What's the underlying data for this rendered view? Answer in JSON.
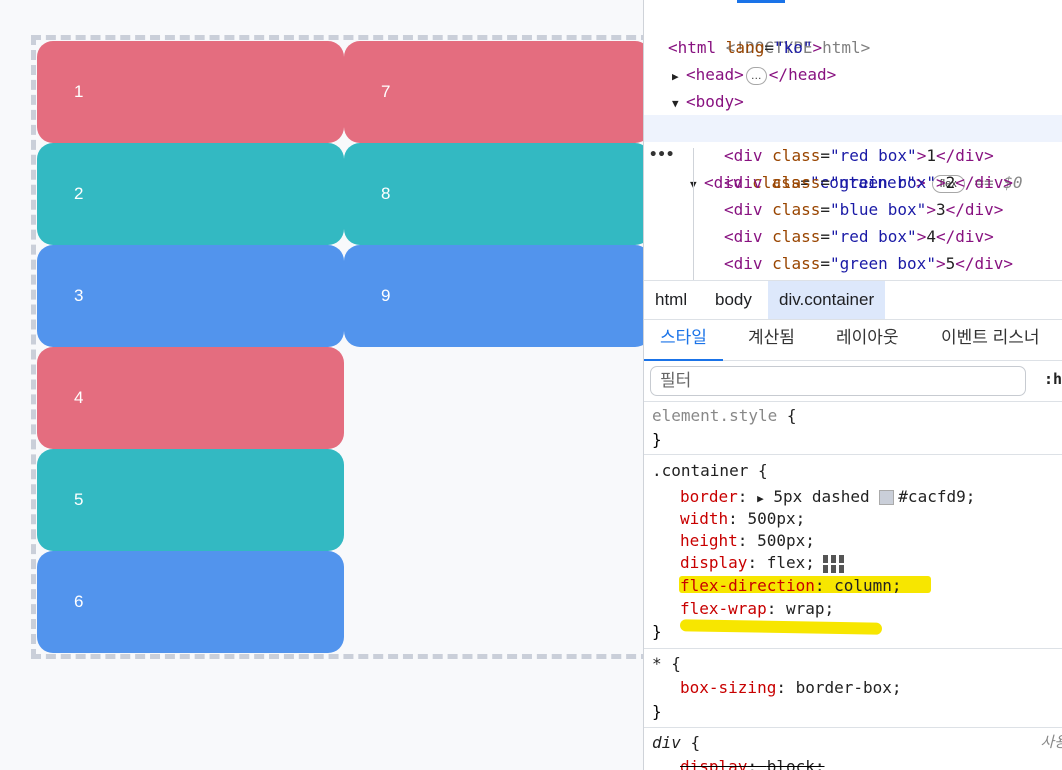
{
  "preview": {
    "boxes": [
      {
        "label": "1",
        "color": "#e46d7f"
      },
      {
        "label": "2",
        "color": "#33b9c2"
      },
      {
        "label": "3",
        "color": "#5294ed"
      },
      {
        "label": "4",
        "color": "#e46d7f"
      },
      {
        "label": "5",
        "color": "#33b9c2"
      },
      {
        "label": "6",
        "color": "#5294ed"
      },
      {
        "label": "7",
        "color": "#e46d7f"
      },
      {
        "label": "8",
        "color": "#33b9c2"
      },
      {
        "label": "9",
        "color": "#5294ed"
      }
    ],
    "border_color": "#cacfd9"
  },
  "elements_panel": {
    "doctype": "<!DOCTYPE html>",
    "html_open": {
      "tag": "<html ",
      "attr": "lang",
      "eq": "=",
      "value": "\"ko\"",
      "close": ">"
    },
    "head": {
      "open": "<head>",
      "ellipsis": "…",
      "close": "</head>"
    },
    "body_open": "<body>",
    "container": {
      "tag": "<div ",
      "attr": "class",
      "value": "\"container\"",
      "close": ">",
      "badge": "flex",
      "eq_ref": "== $0"
    },
    "children": [
      {
        "class_value": "\"red box\"",
        "text": "1"
      },
      {
        "class_value": "\"green box\"",
        "text": "2"
      },
      {
        "class_value": "\"blue box\"",
        "text": "3"
      },
      {
        "class_value": "\"red box\"",
        "text": "4"
      },
      {
        "class_value": "\"green box\"",
        "text": "5"
      }
    ],
    "div_open": "<div ",
    "class_attr": "class",
    "eq": "=",
    "gt": ">",
    "div_close": "</div>"
  },
  "breadcrumbs": [
    "html",
    "body",
    "div.container"
  ],
  "tabs": [
    "스타일",
    "계산됨",
    "레이아웃",
    "이벤트 리스너"
  ],
  "filter": {
    "placeholder": "필터",
    "hov": ":h"
  },
  "styles": {
    "element_style": {
      "selector": "element.style",
      "open": "{",
      "close": "}"
    },
    "container_rule": {
      "selector": ".container",
      "open": "{",
      "close": "}",
      "props": [
        {
          "name": "border",
          "value_pre": "5px dashed",
          "swatch": "#cacfd9",
          "value": "#cacfd9;"
        },
        {
          "name": "width",
          "value": "500px;"
        },
        {
          "name": "height",
          "value": "500px;"
        },
        {
          "name": "display",
          "value": "flex;"
        },
        {
          "name": "flex-direction",
          "value": "column;"
        },
        {
          "name": "flex-wrap",
          "value": "wrap;"
        }
      ]
    },
    "universal_rule": {
      "selector": "*",
      "open": "{",
      "close": "}",
      "props": [
        {
          "name": "box-sizing",
          "value": "border-box;"
        }
      ]
    },
    "div_rule": {
      "selector": "div",
      "open": "{",
      "origin": "사용",
      "props": [
        {
          "name": "display",
          "value": "block;"
        }
      ]
    }
  },
  "highlight_color": "#f7e600"
}
